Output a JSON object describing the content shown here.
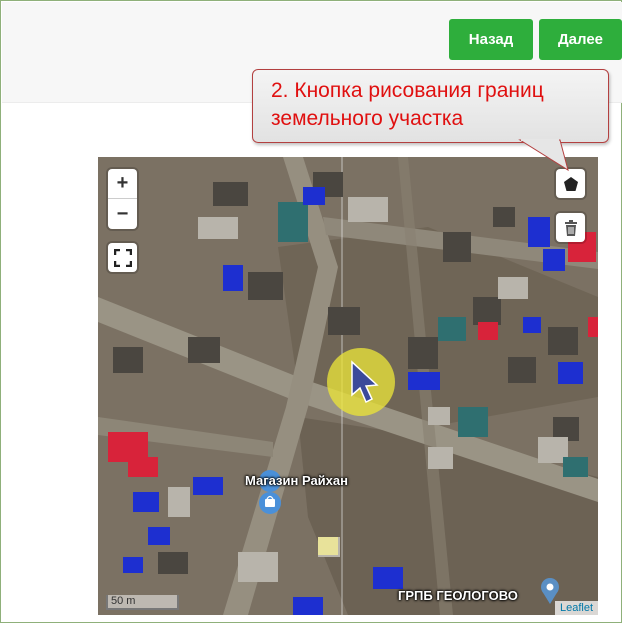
{
  "toolbar": {
    "back_label": "Назад",
    "next_label": "Далее"
  },
  "callout": {
    "line1": "2. Кнопка рисования границ",
    "line2": "земельного участка"
  },
  "map": {
    "zoom_in": "+",
    "zoom_out": "−",
    "labels": {
      "shop": "Магазин Райхан",
      "grpb": "ГРПБ ГЕОЛОГОВО"
    },
    "scale": "50 m",
    "attribution": "Leaflet"
  },
  "icons": {
    "fullscreen": "fullscreen-icon",
    "polygon": "pentagon-icon",
    "trash": "trash-icon",
    "cursor": "arrow-cursor-icon",
    "shop_pin": "shopping-bag-pin-icon",
    "location_pin": "location-pin-icon"
  },
  "colors": {
    "button": "#2eae3c",
    "callout_text": "#e01010",
    "highlight": "#e9e33a"
  }
}
